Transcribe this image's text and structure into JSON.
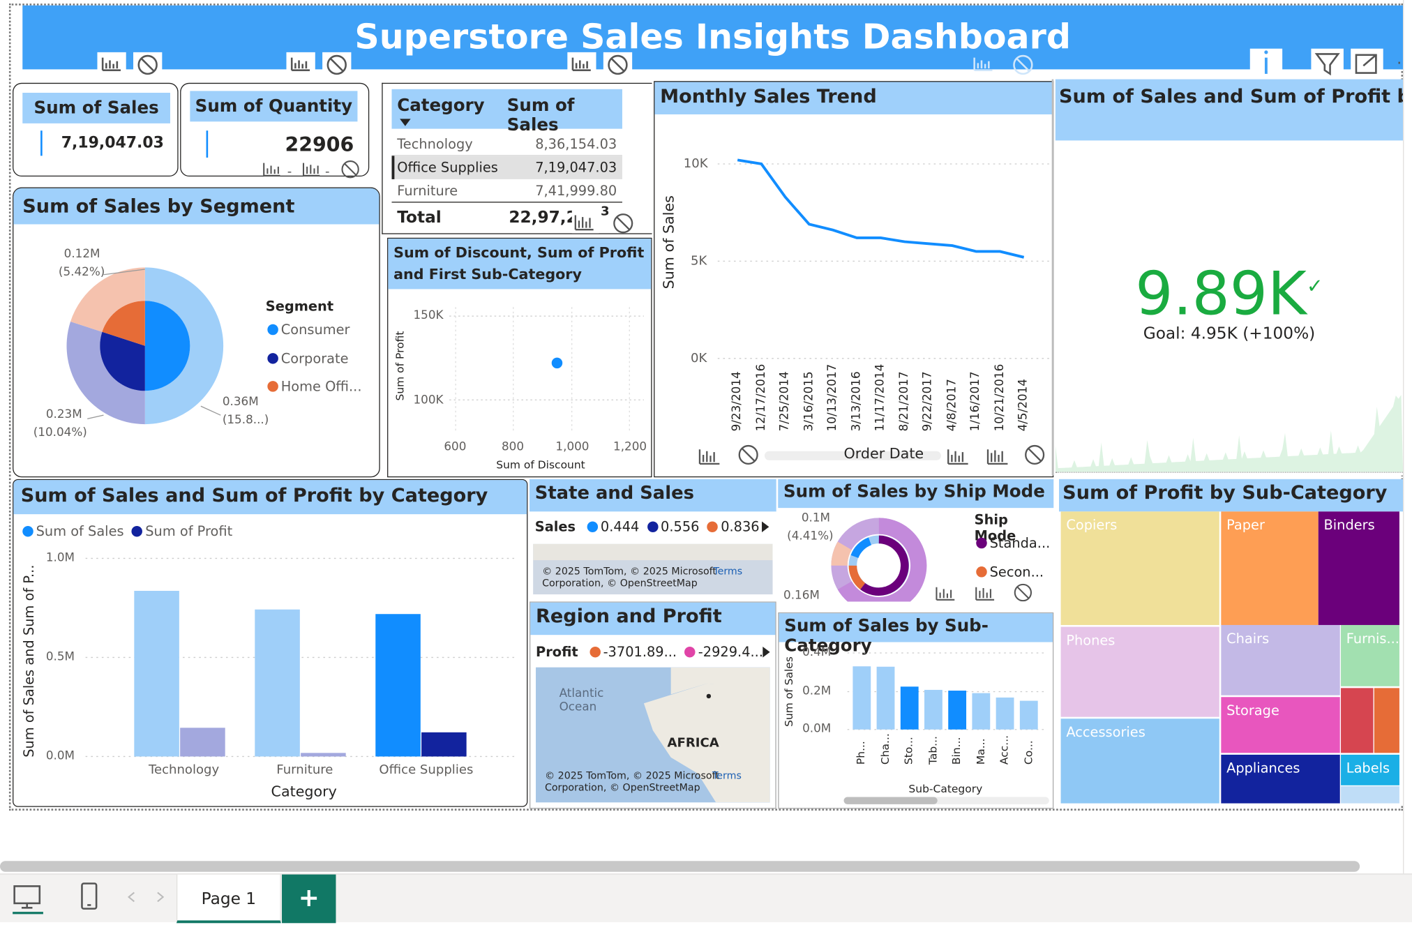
{
  "dashboard": {
    "title": "Superstore Sales Insights Dashboard"
  },
  "kpi_sales": {
    "label": "Sum of Sales",
    "value": "7,19,047.03"
  },
  "kpi_quantity": {
    "label": "Sum of Quantity",
    "value": "22906"
  },
  "category_table": {
    "col1": "Category",
    "col2": "Sum of Sales",
    "rows": [
      {
        "category": "Technology",
        "sales": "8,36,154.03"
      },
      {
        "category": "Office Supplies",
        "sales": "7,19,047.03"
      },
      {
        "category": "Furniture",
        "sales": "7,41,999.80"
      }
    ],
    "total_label": "Total",
    "total_value": "22,97,2",
    "total_trail": "3"
  },
  "segment_donut": {
    "title": "Sum of Sales by Segment",
    "legend_title": "Segment",
    "legend": [
      "Consumer",
      "Corporate",
      "Home Offi..."
    ],
    "labels": {
      "top_value": "0.12M",
      "top_pct": "(5.42%)",
      "left_value": "0.23M",
      "left_pct": "(10.04%)",
      "right_value": "0.36M",
      "right_pct": "(15.8...)"
    },
    "colors": {
      "consumer": "#118DFF",
      "corporate": "#12239E",
      "home_office": "#E66C37"
    }
  },
  "scatter": {
    "title": "Sum of Discount, Sum of Profit and First Sub-Category",
    "ylabel": "Sum of Profit",
    "xlabel": "Sum of Discount",
    "yticks": [
      "150K",
      "100K"
    ],
    "xticks": [
      "600",
      "800",
      "1,000",
      "1,200"
    ]
  },
  "monthly_trend": {
    "title": "Monthly Sales Trend",
    "ylabel": "Sum of Sales",
    "xlabel": "Order Date",
    "yticks": [
      "10K",
      "5K",
      "0K"
    ],
    "xticks": [
      "9/23/2014",
      "12/17/2016",
      "7/25/2014",
      "3/16/2015",
      "10/13/2017",
      "3/13/2016",
      "11/17/2014",
      "8/21/2017",
      "9/22/2017",
      "4/8/2017",
      "1/16/2017",
      "10/21/2016",
      "4/5/2014"
    ]
  },
  "gauge_kpi": {
    "title": "Sum of Sales and Sum of Profit by Profit",
    "value": "9.89K",
    "goal": "Goal: 4.95K (+100%)"
  },
  "category_bars": {
    "title": "Sum of Sales and Sum of Profit by Category",
    "legend": [
      "Sum of Sales",
      "Sum of Profit"
    ],
    "ylabel": "Sum of Sales and Sum of P...",
    "xlabel": "Category",
    "yticks": [
      "1.0M",
      "0.5M",
      "0.0M"
    ],
    "categories": [
      "Technology",
      "Furniture",
      "Office Supplies"
    ]
  },
  "state_map": {
    "title": "State and Sales",
    "legend_label": "Sales",
    "legend_values": [
      "0.444",
      "0.556",
      "0.836"
    ],
    "copyright": "© 2025 TomTom, © 2025 Microsoft Corporation, © OpenStreetMap",
    "terms": "Terms"
  },
  "region_map": {
    "title": "Region and Profit",
    "legend_label": "Profit",
    "legend_values": [
      "-3701.89...",
      "-2929.4..."
    ],
    "places": [
      "Atlantic Ocean",
      "AFRICA"
    ],
    "copyright": "© 2025 TomTom, © 2025 Microsoft Corporation, © OpenStreetMap",
    "terms": "Terms"
  },
  "shipmode_donut": {
    "title": "Sum of Sales by Ship Mode",
    "legend_title": "Ship Mode",
    "legend": [
      "Standa...",
      "Secon..."
    ],
    "labels": {
      "top_value": "0.1M",
      "top_pct": "(4.41%)",
      "bottom_value": "0.16M"
    }
  },
  "subcat_bars": {
    "title": "Sum of Sales by Sub-Category",
    "ylabel": "Sum of Sales",
    "xlabel": "Sub-Category",
    "yticks": [
      "0.4M",
      "0.2M",
      "0.0M"
    ],
    "categories": [
      "Ph...",
      "Cha...",
      "Sto...",
      "Tab...",
      "Bin...",
      "Ma...",
      "Acc...",
      "Co..."
    ]
  },
  "treemap": {
    "title": "Sum of Profit by Sub-Category",
    "tiles": [
      "Copiers",
      "Paper",
      "Binders",
      "Phones",
      "Chairs",
      "Furnis...",
      "Storage",
      "Accessories",
      "Appliances",
      "Labels"
    ]
  },
  "chart_data": [
    {
      "type": "bar",
      "title": "Sum of Sales and Sum of Profit by Category",
      "categories": [
        "Technology",
        "Furniture",
        "Office Supplies"
      ],
      "series": [
        {
          "name": "Sum of Sales",
          "values": [
            836154,
            741999,
            719047
          ]
        },
        {
          "name": "Sum of Profit",
          "values": [
            145000,
            18000,
            122000
          ]
        }
      ],
      "ylim": [
        0,
        1000000
      ],
      "xlabel": "Category",
      "ylabel": "Sum of Sales and Sum of P..."
    },
    {
      "type": "line",
      "title": "Monthly Sales Trend",
      "x": [
        "9/23/2014",
        "12/17/2016",
        "7/25/2014",
        "3/16/2015",
        "10/13/2017",
        "3/13/2016",
        "11/17/2014",
        "8/21/2017",
        "9/22/2017",
        "4/8/2017",
        "1/16/2017",
        "10/21/2016",
        "4/5/2014"
      ],
      "series": [
        {
          "name": "Sum of Sales",
          "values": [
            10200,
            10000,
            8300,
            6900,
            6600,
            6200,
            6200,
            6000,
            5900,
            5800,
            5500,
            5500,
            5200
          ]
        }
      ],
      "ylim": [
        0,
        11000
      ],
      "xlabel": "Order Date",
      "ylabel": "Sum of Sales"
    },
    {
      "type": "scatter",
      "title": "Sum of Discount, Sum of Profit and First Sub-Category",
      "series": [
        {
          "points": [
            [
              950,
              122000
            ]
          ]
        }
      ],
      "xlim": [
        540,
        1240
      ],
      "ylim": [
        80000,
        165000
      ],
      "xlabel": "Sum of Discount",
      "ylabel": "Sum of Profit"
    },
    {
      "type": "bar",
      "title": "Sum of Sales by Sub-Category",
      "categories": [
        "Ph...",
        "Cha...",
        "Sto...",
        "Tab...",
        "Bin...",
        "Ma...",
        "Acc...",
        "Co..."
      ],
      "values": [
        330000,
        328000,
        224000,
        207000,
        203000,
        190000,
        167000,
        150000
      ],
      "ylim": [
        0,
        400000
      ],
      "xlabel": "Sub-Category",
      "ylabel": "Sum of Sales"
    },
    {
      "type": "pie",
      "title": "Sum of Sales by Segment",
      "categories": [
        "Consumer",
        "Corporate",
        "Home Offi..."
      ],
      "values": [
        0.36,
        0.23,
        0.12
      ]
    }
  ],
  "statusbar": {
    "page_tab": "Page 1",
    "add_label": "+"
  },
  "icons": [
    "drill-icon",
    "block-icon",
    "filter-icon",
    "focus-icon",
    "info-icon",
    "desktop-icon",
    "phone-icon",
    "prev-icon",
    "next-icon"
  ]
}
